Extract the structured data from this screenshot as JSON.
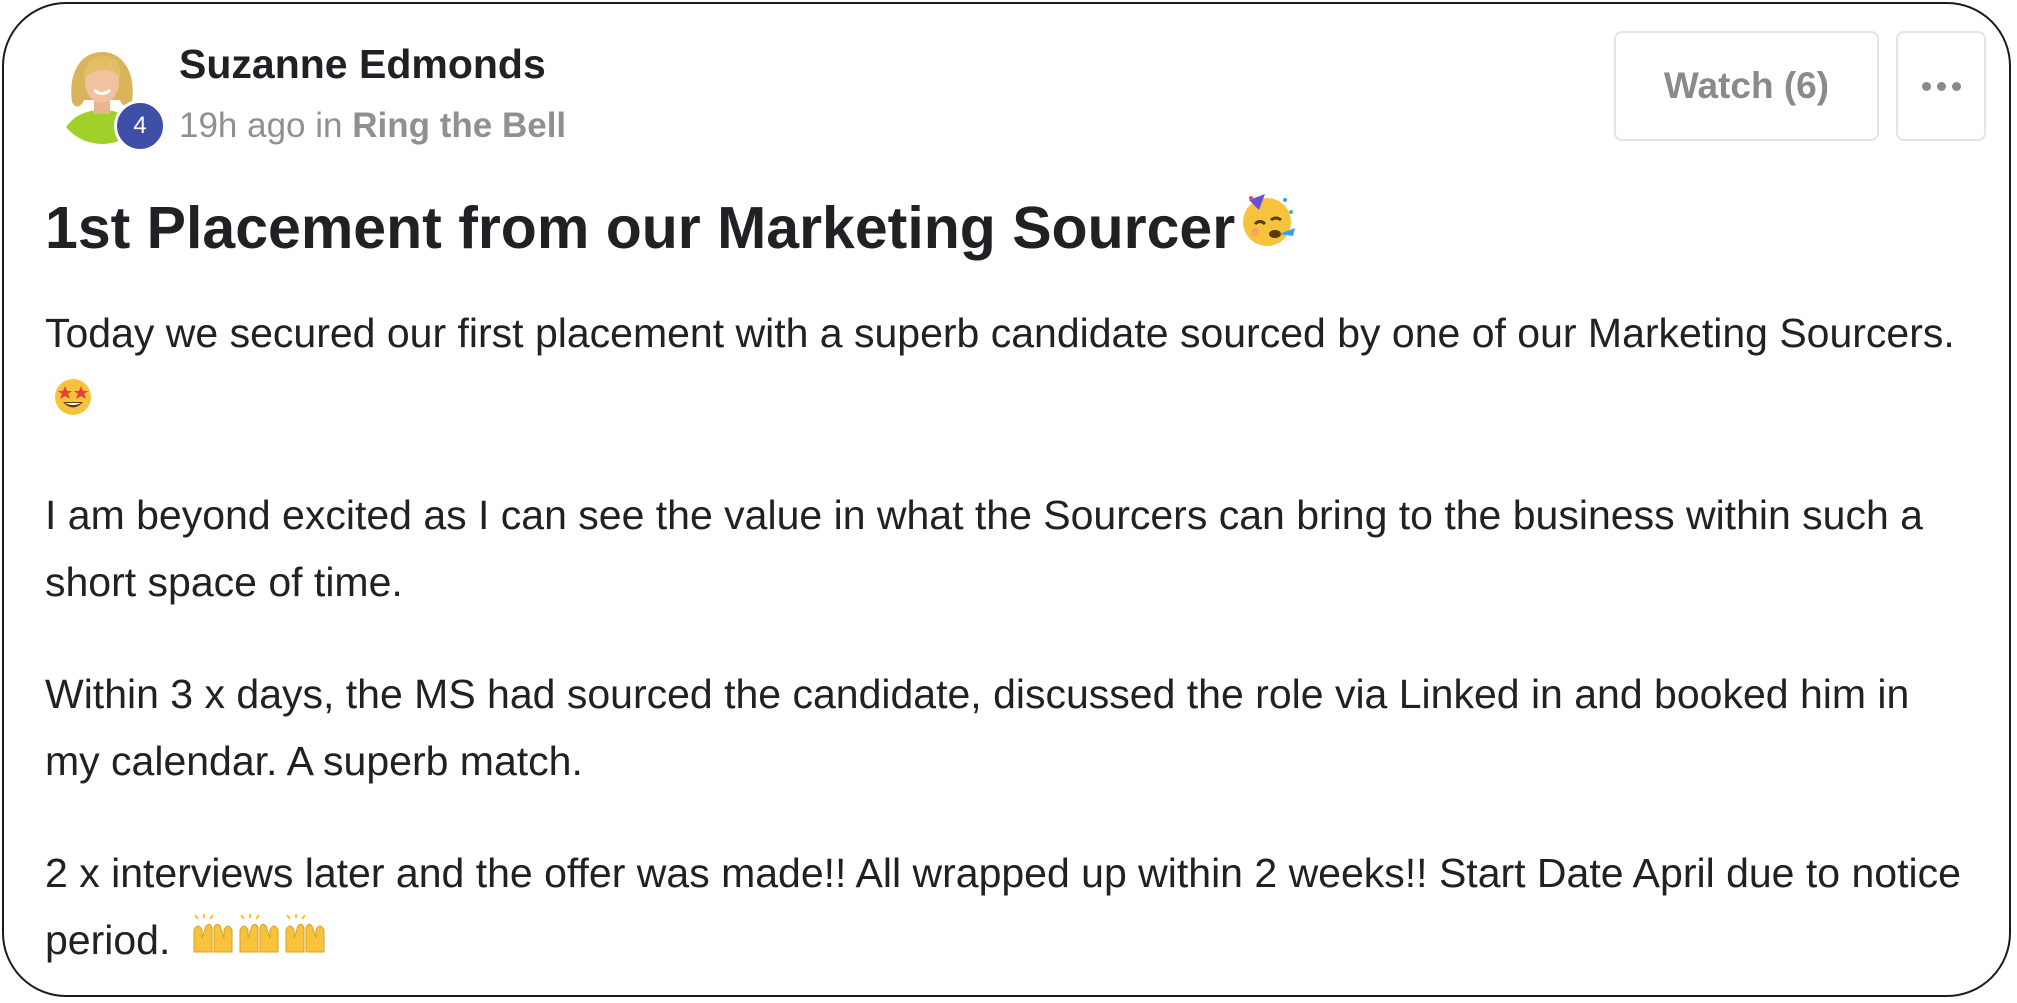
{
  "author": {
    "name": "Suzanne Edmonds",
    "level": "4",
    "avatar_icon": "user-avatar-photo"
  },
  "meta": {
    "time_ago": "19h ago",
    "in_label": "in",
    "category": "Ring the Bell"
  },
  "actions": {
    "watch_label": "Watch (6)",
    "more_icon": "ellipsis-icon"
  },
  "post": {
    "title": "1st Placement from our Marketing Sourcer",
    "title_emoji": "partying-face",
    "paragraphs": [
      {
        "text": "Today we secured our first placement with a superb candidate sourced by one of our Marketing Sourcers.",
        "emoji": "star-struck"
      },
      {
        "text": "I am beyond excited as I can see the value in what the Sourcers can bring to the business within such a short space of time.",
        "emoji": ""
      },
      {
        "text": "Within 3 x days, the MS had sourced the candidate, discussed the role via Linked in and booked him in my calendar. A superb match.",
        "emoji": ""
      },
      {
        "text": "2 x interviews later and the offer was made!! All wrapped up within 2 weeks!! Start Date April due to notice period.",
        "emoji": "raising-hands-x3"
      }
    ]
  },
  "colors": {
    "badge": "#3f4fa8",
    "muted_text": "#909090",
    "border": "#e4e4e4",
    "text": "#202124"
  }
}
